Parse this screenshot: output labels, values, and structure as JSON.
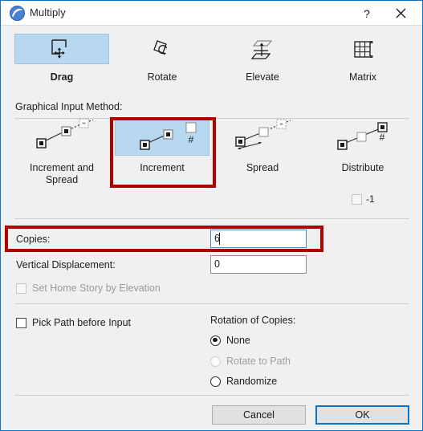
{
  "window": {
    "title": "Multiply",
    "app_icon": "archicad-orb-icon",
    "help_label": "?",
    "close_label": "close-icon"
  },
  "tabs": [
    {
      "label": "Drag",
      "icon": "drag-icon",
      "selected": true
    },
    {
      "label": "Rotate",
      "icon": "rotate-icon",
      "selected": false
    },
    {
      "label": "Elevate",
      "icon": "elevate-icon",
      "selected": false
    },
    {
      "label": "Matrix",
      "icon": "matrix-icon",
      "selected": false
    }
  ],
  "graphical_input": {
    "section_label": "Graphical Input Method:",
    "methods": [
      {
        "label": "Increment and Spread",
        "icon": "increment-and-spread-icon",
        "selected": false
      },
      {
        "label": "Increment",
        "icon": "increment-icon",
        "selected": true
      },
      {
        "label": "Spread",
        "icon": "spread-icon",
        "selected": false
      },
      {
        "label": "Distribute",
        "icon": "distribute-icon",
        "selected": false
      }
    ],
    "minus_one": {
      "label": "-1",
      "checked": false,
      "enabled": false
    }
  },
  "fields": {
    "copies": {
      "label": "Copies:",
      "value": "6",
      "focused": true
    },
    "vertical_displacement": {
      "label": "Vertical Displacement:",
      "value": "0",
      "focused": false
    },
    "set_home_story": {
      "label": "Set Home Story by Elevation",
      "checked": false,
      "enabled": false
    },
    "pick_path": {
      "label": "Pick Path before Input",
      "checked": false,
      "enabled": true
    }
  },
  "rotation": {
    "label": "Rotation of Copies:",
    "options": [
      {
        "label": "None",
        "checked": true,
        "enabled": true
      },
      {
        "label": "Rotate to Path",
        "checked": false,
        "enabled": false
      },
      {
        "label": "Randomize",
        "checked": false,
        "enabled": true
      }
    ]
  },
  "buttons": {
    "cancel": "Cancel",
    "ok": "OK"
  },
  "colors": {
    "accent": "#0a74c8",
    "selection": "#b8d8f0",
    "highlight_box": "#b00000",
    "dialog_bg": "#f0f0f0"
  }
}
